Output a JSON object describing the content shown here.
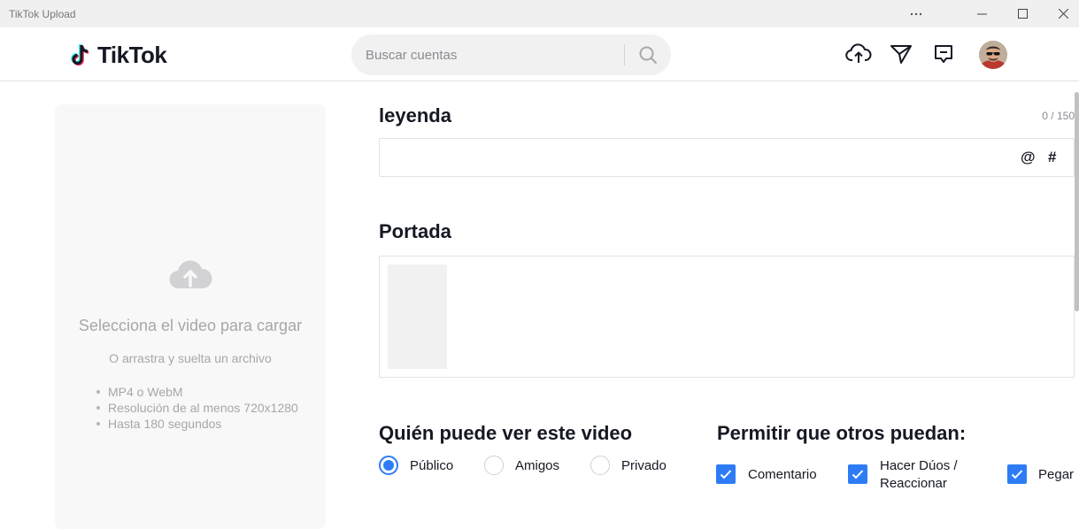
{
  "window": {
    "title": "TikTok Upload",
    "controls": {
      "more": "more-horizontal-icon",
      "minimize": "minimize-icon",
      "maximize": "maximize-icon",
      "close": "close-icon"
    }
  },
  "header": {
    "logo_text": "TikTok",
    "search": {
      "placeholder": "Buscar cuentas",
      "value": ""
    },
    "icons": [
      "upload-cloud-icon",
      "send-icon",
      "inbox-icon",
      "avatar"
    ]
  },
  "upload": {
    "title": "Selecciona el video para cargar",
    "subtitle": "O arrastra y suelta un archivo",
    "requirements": [
      "MP4 o WebM",
      "Resolución de al menos 720x1280",
      "Hasta 180 segundos"
    ]
  },
  "caption": {
    "label": "leyenda",
    "counter": "0 / 150",
    "value": "",
    "at_symbol": "@",
    "hash_symbol": "#"
  },
  "cover": {
    "label": "Portada"
  },
  "privacy": {
    "label": "Quién puede ver este video",
    "options": [
      {
        "label": "Público",
        "selected": true
      },
      {
        "label": "Amigos",
        "selected": false
      },
      {
        "label": "Privado",
        "selected": false
      }
    ]
  },
  "permissions": {
    "label": "Permitir que otros puedan:",
    "options": [
      {
        "label_line1": "Comentario",
        "label_line2": "",
        "checked": true
      },
      {
        "label_line1": "Hacer Dúos /",
        "label_line2": "Reaccionar",
        "checked": true
      },
      {
        "label_line1": "Pegar",
        "label_line2": "",
        "checked": true
      }
    ]
  },
  "colors": {
    "accent": "#2d7cf6",
    "brand_cyan": "#25f4ee",
    "brand_pink": "#fe2c55"
  }
}
